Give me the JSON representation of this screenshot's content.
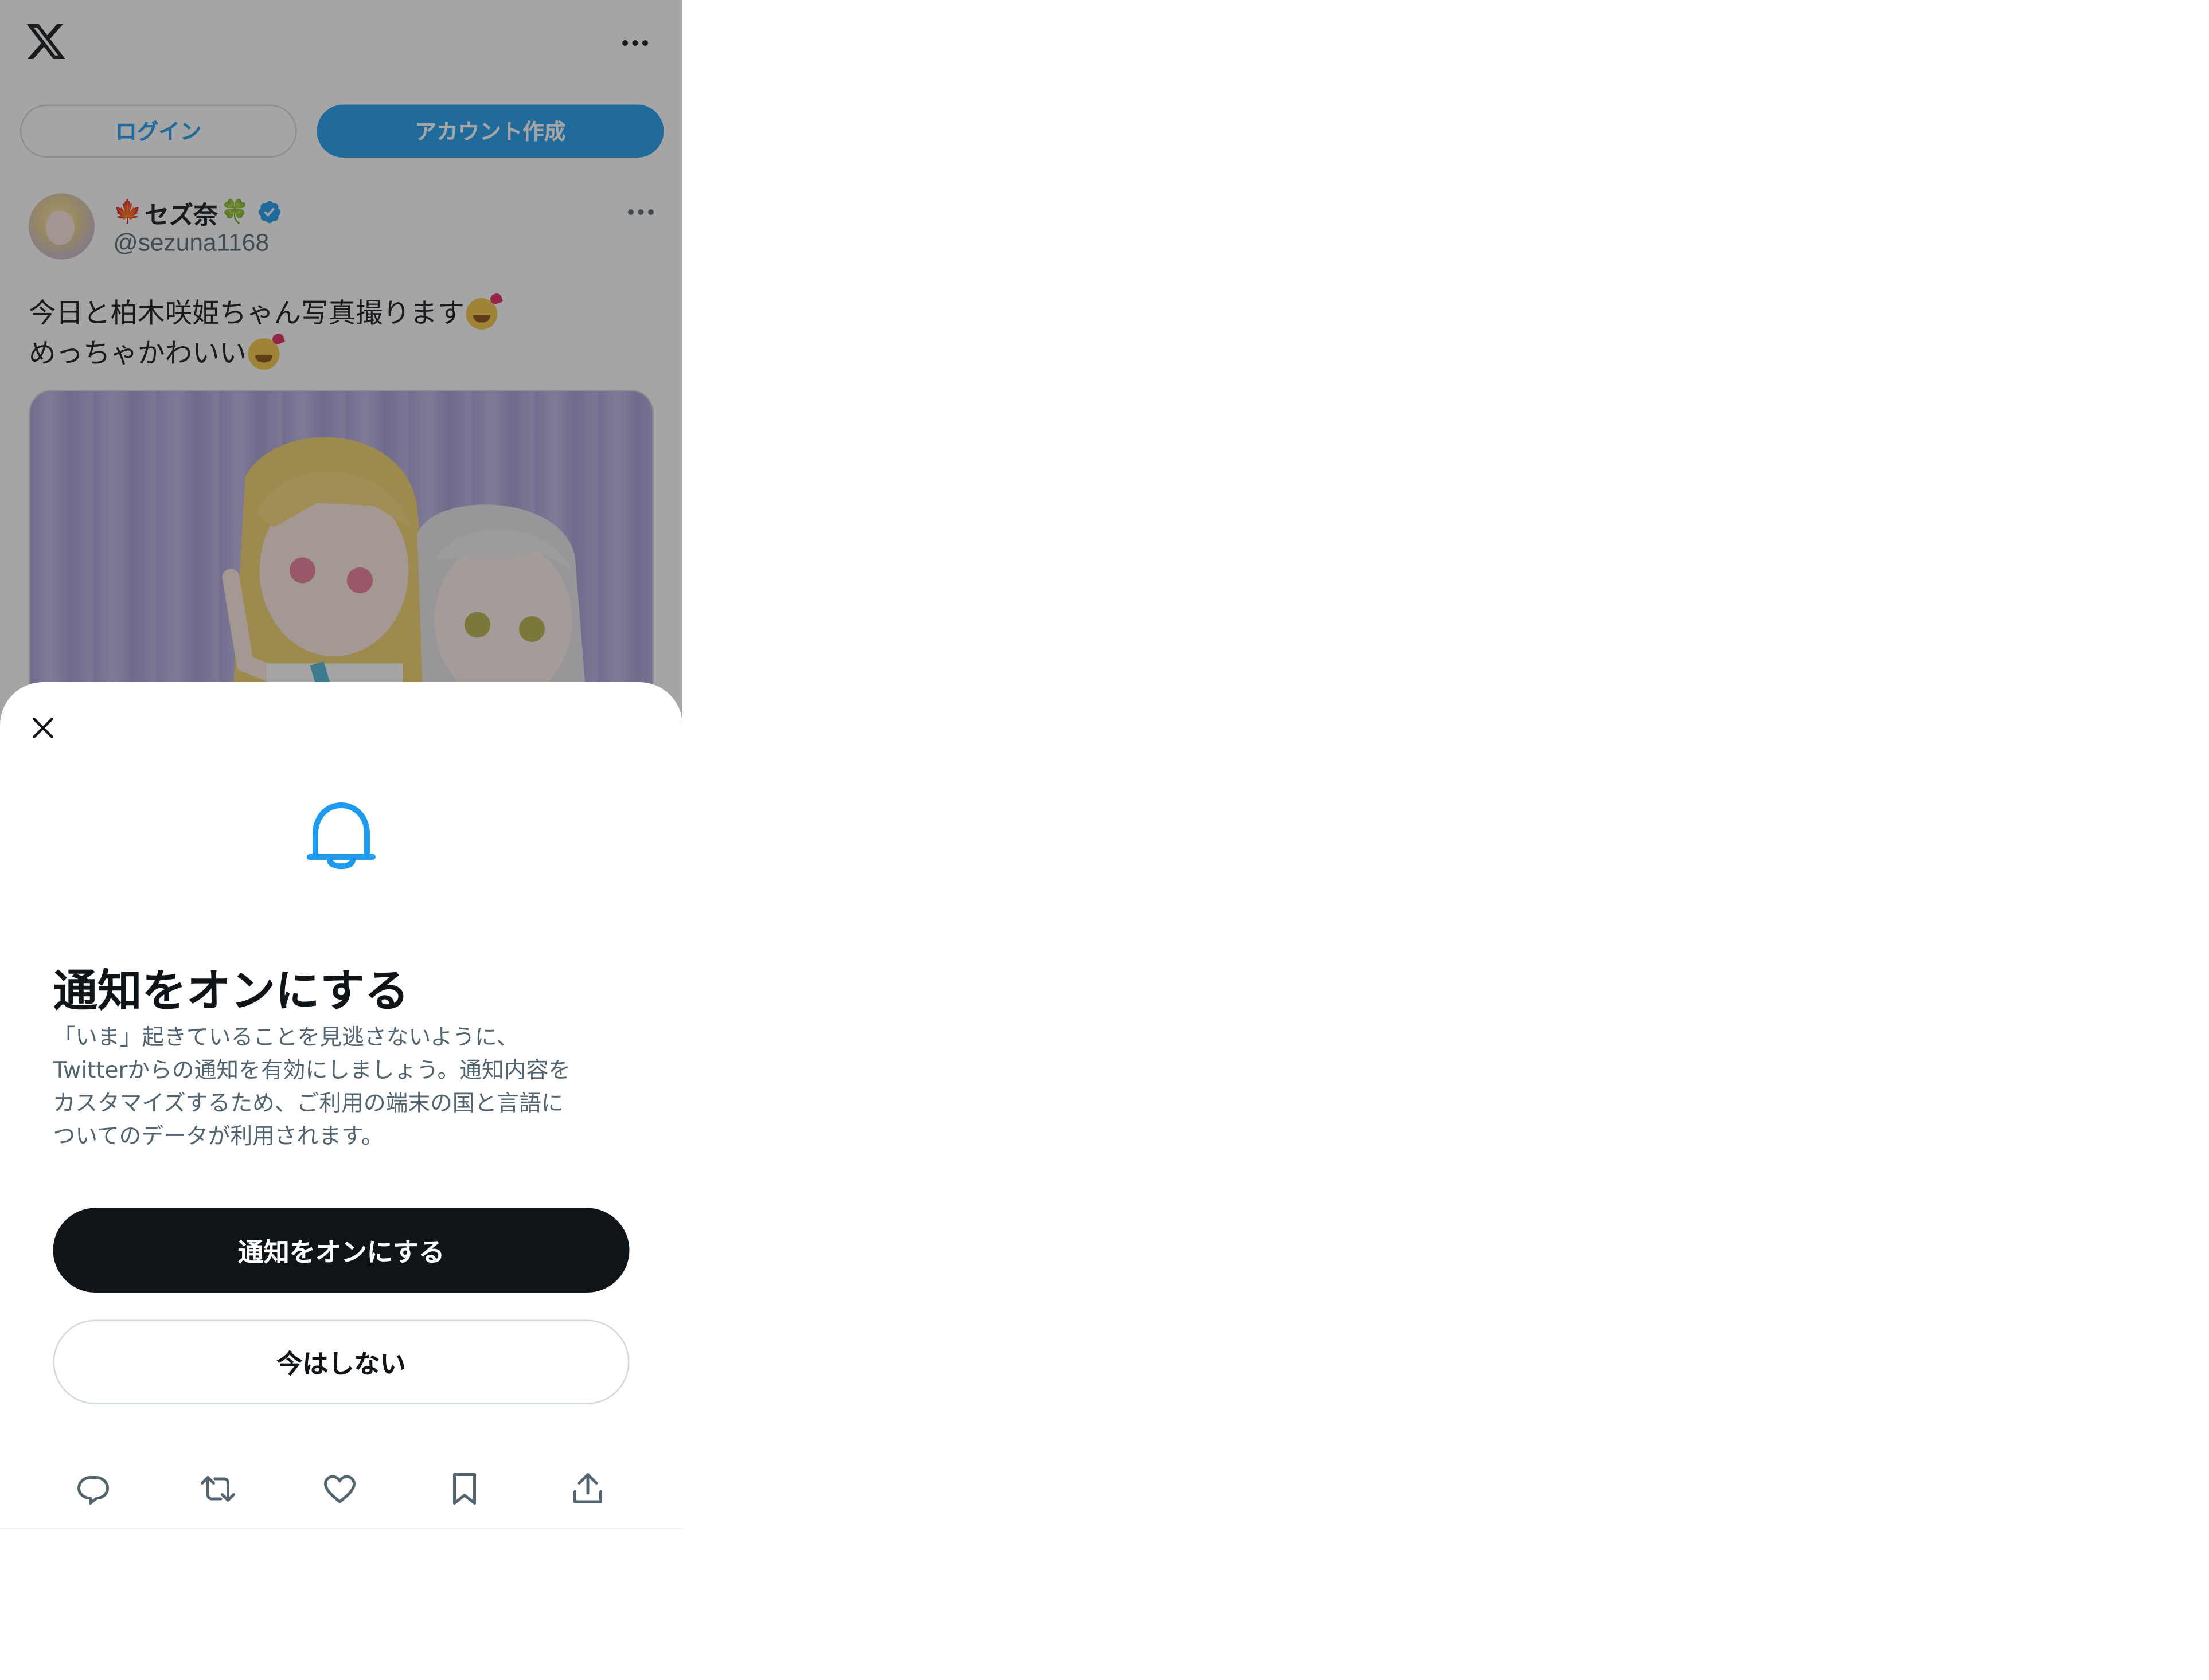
{
  "header": {
    "logo_icon": "x-logo-icon",
    "more_icon": "more-horizontal-icon"
  },
  "auth": {
    "login_label": "ログイン",
    "signup_label": "アカウント作成"
  },
  "post": {
    "display_name": "セズ奈",
    "name_prefix_emoji": "🍁",
    "name_suffix_emoji": "🍀",
    "verified_icon": "verified-badge-icon",
    "handle": "@sezuna1168",
    "text_line_1": "今日と柏木咲姫ちゃん写真撮ります",
    "text_line_2": "めっちゃかわいい",
    "emoji_name": "smiling-face-with-hearts"
  },
  "sheet": {
    "close_icon": "close-icon",
    "bell_icon": "bell-icon",
    "title": "通知をオンにする",
    "description_lines": [
      "「いま」起きていることを見逃さないように、",
      "Twitterからの通知を有効にしましょう。通知内容を",
      "カスタマイズするため、ご利用の端末の国と言語に",
      "ついてのデータが利用されます。"
    ],
    "primary_label": "通知をオンにする",
    "secondary_label": "今はしない"
  },
  "actions": [
    "reply-icon",
    "retweet-icon",
    "like-icon",
    "bookmark-icon",
    "share-icon"
  ],
  "colors": {
    "accent": "#1d9bf0",
    "text_primary": "#0f1419",
    "text_secondary": "#536471",
    "border": "#cfd9de"
  }
}
